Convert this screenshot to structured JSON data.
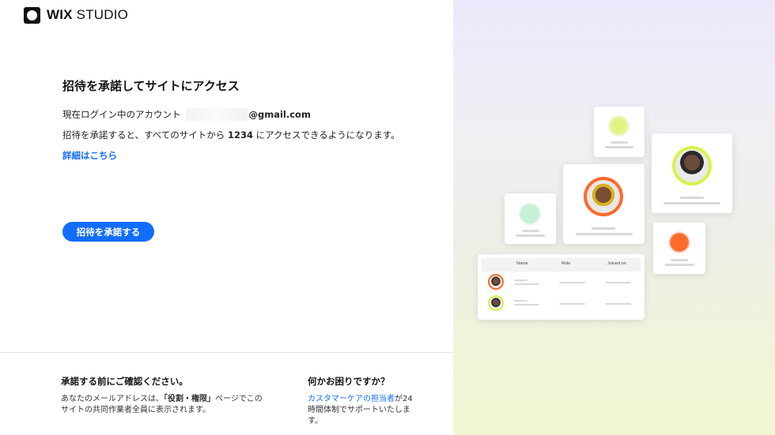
{
  "brand": {
    "logo_bold": "WIX",
    "logo_light": "STUDIO"
  },
  "main": {
    "heading": "招待を承諾してサイトにアクセス",
    "account_prefix": "現在ログイン中のアカウント",
    "account_email_suffix": "@gmail.com",
    "access_text_before": "招待を承諾すると、すべてのサイトから ",
    "site_name": "1234",
    "access_text_after": " にアクセスできるようになります。",
    "learn_more": "詳細はこちら",
    "accept_button": "招待を承諾する"
  },
  "footer": {
    "confirm_title": "承諾する前にご確認ください。",
    "confirm_text_before": "あなたのメールアドレスは、",
    "confirm_text_bold": "「役割・権限」",
    "confirm_text_after": "ページでこのサイトの共同作業者全員に表示されます。",
    "help_title": "何かお困りですか？",
    "help_link": "カスタマーケアの担当者",
    "help_text_after": "が24時間体制でサポートいたします。"
  },
  "illustration": {
    "table_headers": [
      "Name",
      "Role",
      "Joined on"
    ]
  },
  "colors": {
    "accent": "#116dff",
    "lime": "#d9f24a",
    "orange": "#ff6a2a",
    "mint": "#c8f0d8"
  }
}
